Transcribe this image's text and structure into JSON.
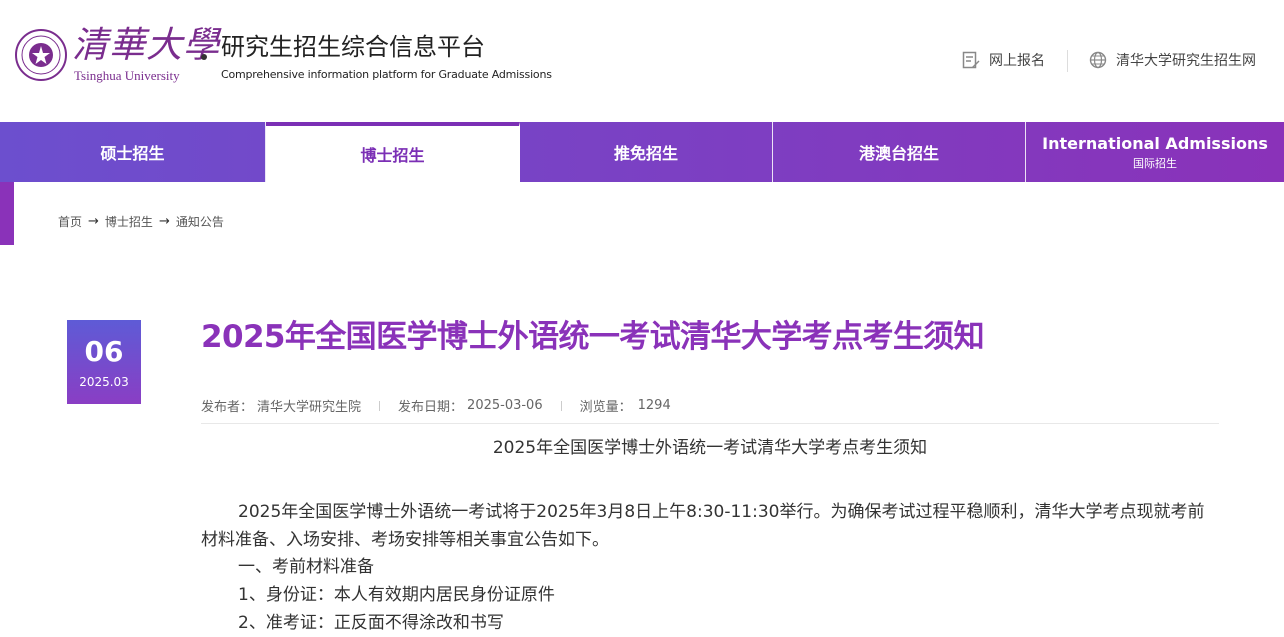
{
  "header": {
    "logo_cn": "清華大學",
    "logo_en": "Tsinghua University",
    "site_title": "研究生招生综合信息平台",
    "site_subtitle": "Comprehensive information platform for Graduate Admissions",
    "links": [
      "网上报名",
      "清华大学研究生招生网"
    ]
  },
  "nav": {
    "items": [
      {
        "label": "硕士招生"
      },
      {
        "label": "博士招生",
        "active": true
      },
      {
        "label": "推免招生"
      },
      {
        "label": "港澳台招生"
      },
      {
        "label": "International Admissions",
        "sub": "国际招生"
      }
    ]
  },
  "breadcrumb": [
    "首页",
    "博士招生",
    "通知公告"
  ],
  "article": {
    "date_day": "06",
    "date_ym": "2025.03",
    "title": "2025年全国医学博士外语统一考试清华大学考点考生须知",
    "publisher_label": "发布者：",
    "publisher": "清华大学研究生院",
    "date_label": "发布日期：",
    "date": "2025-03-06",
    "views_label": "浏览量：",
    "views": "1294",
    "heading": "2025年全国医学博士外语统一考试清华大学考点考生须知",
    "paragraphs": [
      "2025年全国医学博士外语统一考试将于2025年3月8日上午8:30-11:30举行。为确保考试过程平稳顺利，清华大学考点现就考前材料准备、入场安排、考场安排等相关事宜公告如下。",
      "一、考前材料准备",
      "1、身份证：本人有效期内居民身份证原件",
      "2、准考证：正反面不得涂改和书写"
    ]
  },
  "colors": {
    "brand_purple": "#8a32b9",
    "nav_start": "#6c4fce"
  },
  "icons": [
    "tsinghua-seal-icon",
    "edit-form-icon",
    "globe-icon",
    "arrow-right-icon"
  ]
}
